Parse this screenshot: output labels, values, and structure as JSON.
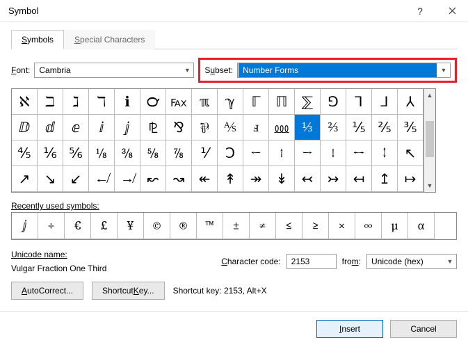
{
  "titlebar": {
    "title": "Symbol"
  },
  "tabs": {
    "symbols": "Symbols",
    "special": "Special Characters"
  },
  "font": {
    "label": "Font:",
    "value": "Cambria"
  },
  "subset": {
    "label": "Subset:",
    "value": "Number Forms"
  },
  "grid": {
    "selected_index": 27,
    "cells": [
      "ℵ",
      "ℶ",
      "ℷ",
      "ℸ",
      "ℹ",
      "℺",
      "℻",
      "ℼ",
      "ℽ",
      "ℾ",
      "ℿ",
      "⅀",
      "⅁",
      "⅂",
      "⅃",
      "⅄",
      "ⅅ",
      "ⅆ",
      "ⅇ",
      "ⅈ",
      "ⅉ",
      "⅊",
      "⅋",
      "⅌",
      "⅍",
      "ⅎ",
      "⅏",
      "⅓",
      "⅔",
      "⅕",
      "⅖",
      "⅗",
      "⅘",
      "⅙",
      "⅚",
      "⅛",
      "⅜",
      "⅝",
      "⅞",
      "⅟",
      "Ↄ",
      "←",
      "↑",
      "→",
      "↓",
      "↔",
      "↕",
      "↖",
      "↗",
      "↘",
      "↙",
      "↚",
      "↛",
      "↜",
      "↝",
      "↞",
      "↟",
      "↠",
      "↡",
      "↢",
      "↣",
      "↤",
      "↥",
      "↦"
    ]
  },
  "recent": {
    "label": "Recently used symbols:",
    "cells": [
      "ⅉ",
      "÷",
      "€",
      "£",
      "¥",
      "©",
      "®",
      "™",
      "±",
      "≠",
      "≤",
      "≥",
      "×",
      "∞",
      "µ",
      "α"
    ]
  },
  "unicode_name": {
    "label": "Unicode name:",
    "value": "Vulgar Fraction One Third"
  },
  "charcode": {
    "label": "Character code:",
    "value": "2153"
  },
  "from": {
    "label": "from:",
    "value": "Unicode (hex)"
  },
  "buttons": {
    "autocorrect": "AutoCorrect...",
    "shortcut": "Shortcut Key...",
    "shortcut_info_label": "Shortcut key:",
    "shortcut_info_value": "2153, Alt+X",
    "insert": "Insert",
    "cancel": "Cancel"
  }
}
